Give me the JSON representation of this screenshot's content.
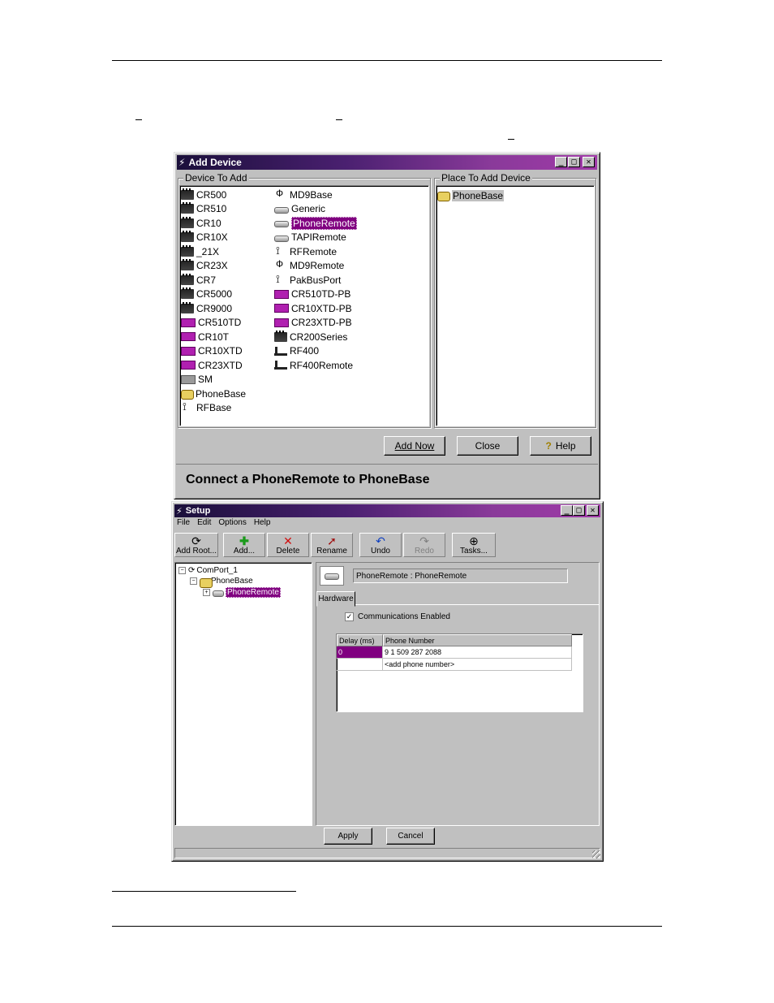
{
  "add_device": {
    "title": "Add Device",
    "device_group_label": "Device To Add",
    "place_group_label": "Place To Add Device",
    "devices_col1": [
      {
        "label": "CR500",
        "icon": "datalogger-icon"
      },
      {
        "label": "CR510",
        "icon": "datalogger-icon"
      },
      {
        "label": "CR10",
        "icon": "datalogger-icon"
      },
      {
        "label": "CR10X",
        "icon": "datalogger-icon"
      },
      {
        "label": "_21X",
        "icon": "datalogger-icon"
      },
      {
        "label": "CR23X",
        "icon": "datalogger-icon"
      },
      {
        "label": "CR7",
        "icon": "datalogger-icon"
      },
      {
        "label": "CR5000",
        "icon": "datalogger-icon"
      },
      {
        "label": "CR9000",
        "icon": "datalogger-icon"
      },
      {
        "label": "CR510TD",
        "icon": "datalogger-td-icon"
      },
      {
        "label": "CR10T",
        "icon": "datalogger-td-icon"
      },
      {
        "label": "CR10XTD",
        "icon": "datalogger-td-icon"
      },
      {
        "label": "CR23XTD",
        "icon": "datalogger-td-icon"
      },
      {
        "label": "SM",
        "icon": "storage-module-icon"
      },
      {
        "label": "PhoneBase",
        "icon": "phone-icon"
      },
      {
        "label": "RFBase",
        "icon": "radio-icon"
      }
    ],
    "devices_col2": [
      {
        "label": "MD9Base",
        "icon": "antenna-icon"
      },
      {
        "label": "Generic",
        "icon": "modem-icon"
      },
      {
        "label": "PhoneRemote",
        "icon": "modem-icon",
        "selected": true
      },
      {
        "label": "TAPIRemote",
        "icon": "modem-icon"
      },
      {
        "label": "RFRemote",
        "icon": "radio-icon"
      },
      {
        "label": "MD9Remote",
        "icon": "antenna-icon"
      },
      {
        "label": "PakBusPort",
        "icon": "port-icon"
      },
      {
        "label": "CR510TD-PB",
        "icon": "datalogger-td-icon"
      },
      {
        "label": "CR10XTD-PB",
        "icon": "datalogger-td-icon"
      },
      {
        "label": "CR23XTD-PB",
        "icon": "datalogger-td-icon"
      },
      {
        "label": "CR200Series",
        "icon": "datalogger-icon"
      },
      {
        "label": "RF400",
        "icon": "rf400-icon"
      },
      {
        "label": "RF400Remote",
        "icon": "rf400-icon"
      }
    ],
    "place_items": [
      {
        "label": "PhoneBase",
        "icon": "phone-icon"
      }
    ],
    "buttons": {
      "add_now": "Add Now",
      "close": "Close",
      "help": "Help"
    },
    "status": "Connect a PhoneRemote to PhoneBase"
  },
  "setup": {
    "title": "Setup",
    "menu": [
      "File",
      "Edit",
      "Options",
      "Help"
    ],
    "toolbar": [
      "Add Root...",
      "Add...",
      "Delete",
      "Rename",
      "Undo",
      "Redo",
      "Tasks..."
    ],
    "tree": {
      "root": "ComPort_1",
      "child": "PhoneBase",
      "grandchild": "PhoneRemote"
    },
    "header_name": "PhoneRemote : PhoneRemote",
    "tab": "Hardware",
    "comm_enabled_label": "Communications Enabled",
    "comm_enabled": true,
    "table": {
      "columns": [
        "Delay (ms)",
        "Phone Number"
      ],
      "rows": [
        [
          "0",
          "9 1 509 287 2088"
        ],
        [
          "",
          "<add phone number>"
        ]
      ]
    },
    "buttons": {
      "apply": "Apply",
      "cancel": "Cancel"
    }
  }
}
